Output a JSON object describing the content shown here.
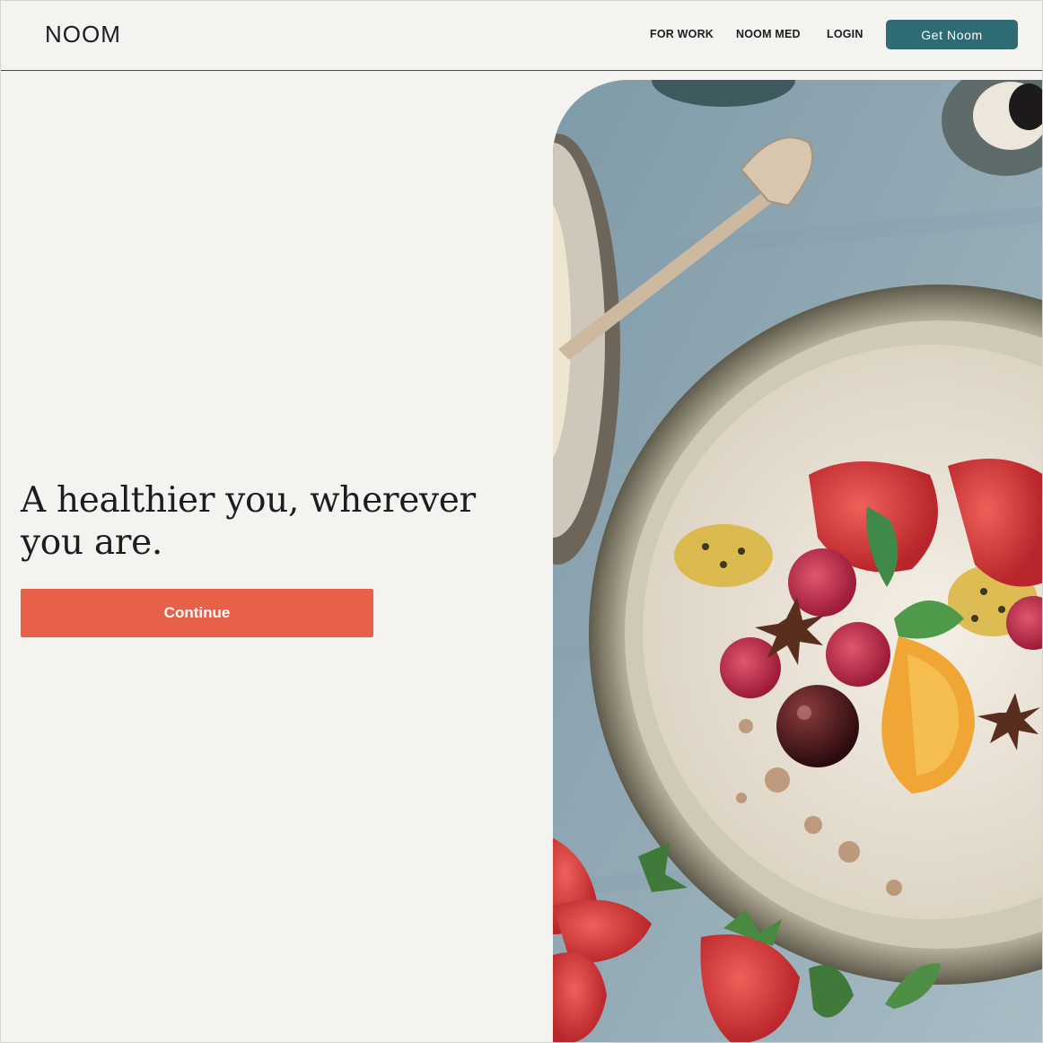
{
  "header": {
    "logo": "NOOM",
    "nav": {
      "for_work": "FOR WORK",
      "noom_med": "NOOM MED",
      "login": "LOGIN"
    },
    "cta": "Get Noom"
  },
  "hero": {
    "headline": "A healthier you, wherever you are.",
    "continue": "Continue"
  },
  "colors": {
    "background": "#f5f3ef",
    "cta_teal": "#2e6b73",
    "continue_orange": "#e8604a"
  }
}
